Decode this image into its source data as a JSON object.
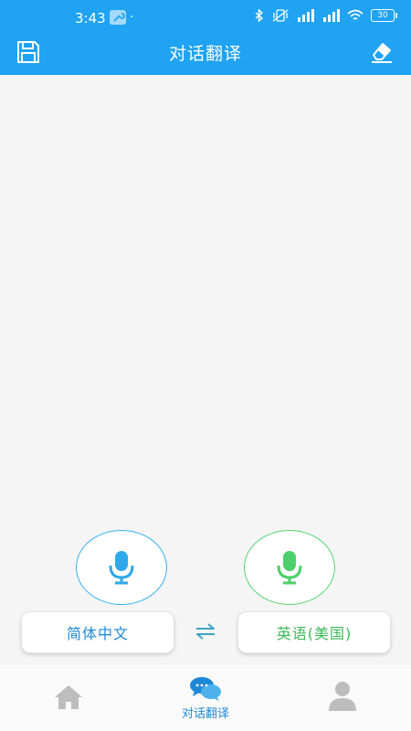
{
  "status_bar": {
    "time": "3:43",
    "dot": "·",
    "battery": "30"
  },
  "header": {
    "title": "对话翻译",
    "save_icon": "save-icon",
    "erase_icon": "eraser-icon"
  },
  "mic": {
    "left_icon": "microphone-icon",
    "right_icon": "microphone-icon",
    "left_color": "#3ab3ef",
    "right_color": "#58d474"
  },
  "languages": {
    "source": "简体中文",
    "target": "英语(美国)",
    "swap_icon": "swap-arrows-icon"
  },
  "tabbar": {
    "home_icon": "home-icon",
    "chat_label": "对话翻译",
    "chat_icon": "chat-bubbles-icon",
    "profile_icon": "user-icon"
  },
  "colors": {
    "header_bg": "#1fa3f2",
    "accent_blue": "#1e88d6",
    "accent_green": "#3cb959"
  }
}
